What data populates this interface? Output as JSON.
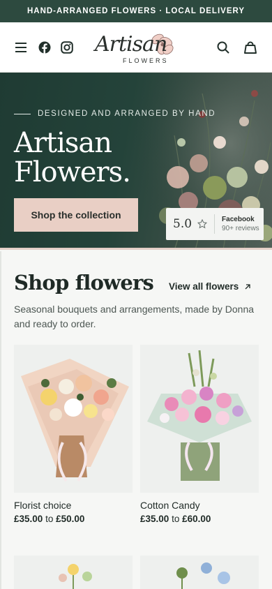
{
  "announcement": "HAND-ARRANGED FLOWERS · LOCAL DELIVERY",
  "header": {
    "logo_word": "Artisan",
    "logo_sub": "FLOWERS",
    "icons": [
      "menu-icon",
      "facebook-icon",
      "instagram-icon",
      "search-icon",
      "bag-icon"
    ]
  },
  "hero": {
    "kicker": "DESIGNED AND ARRANGED BY HAND",
    "title_line1": "Artisan",
    "title_line2": "Flowers.",
    "cta": "Shop the collection",
    "rating": {
      "score": "5.0",
      "source": "Facebook",
      "count": "90+ reviews"
    }
  },
  "shop": {
    "title": "Shop flowers",
    "view_all": "View all flowers",
    "description": "Seasonal bouquets and arrangements, made by Donna and ready to order.",
    "products": [
      {
        "name": "Florist choice",
        "price_from": "£35.00",
        "price_sep": "to",
        "price_to": "£50.00"
      },
      {
        "name": "Cotton Candy",
        "price_from": "£35.00",
        "price_sep": "to",
        "price_to": "£60.00"
      }
    ]
  },
  "colors": {
    "accent_dark": "#2d4a3f",
    "cta": "#e9cfc5"
  }
}
